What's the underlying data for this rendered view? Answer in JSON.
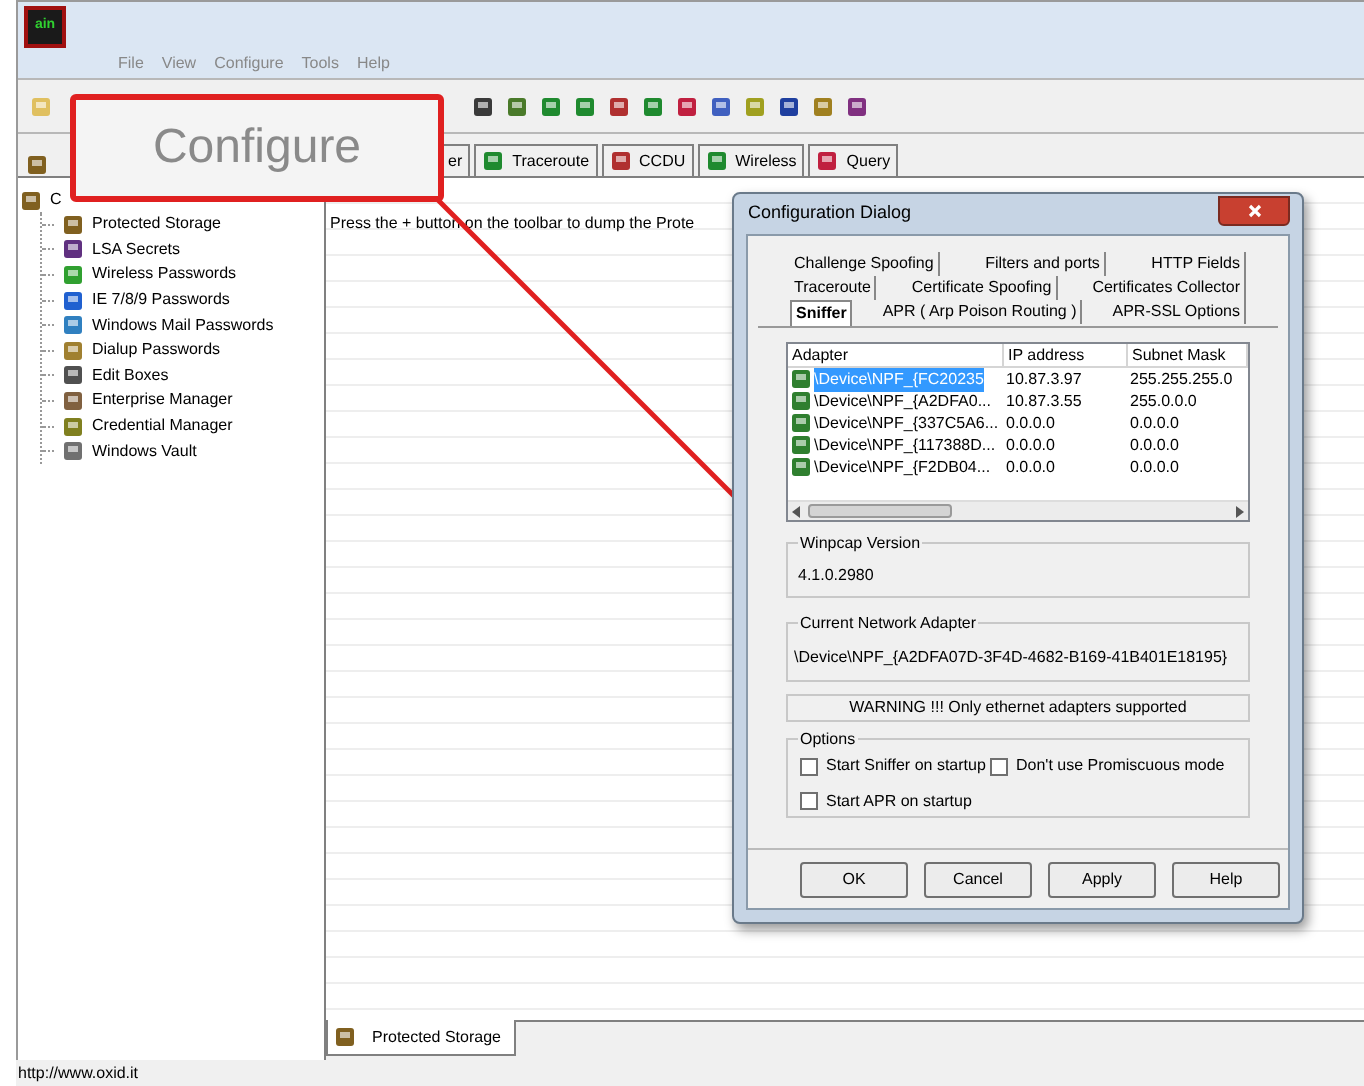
{
  "app": {
    "logo_text": "ain",
    "menu": [
      "File",
      "View",
      "Configure",
      "Tools",
      "Help"
    ]
  },
  "tabs": [
    {
      "label": "er"
    },
    {
      "label": "Traceroute"
    },
    {
      "label": "CCDU"
    },
    {
      "label": "Wireless"
    },
    {
      "label": "Query"
    }
  ],
  "callout": {
    "text": "Configure"
  },
  "tree": {
    "root": "C",
    "items": [
      "Protected Storage",
      "LSA Secrets",
      "Wireless Passwords",
      "IE 7/8/9 Passwords",
      "Windows Mail Passwords",
      "Dialup Passwords",
      "Edit Boxes",
      "Enterprise Manager",
      "Credential Manager",
      "Windows Vault"
    ]
  },
  "content": {
    "message": "Press the + button on the toolbar to dump the Prote"
  },
  "bottom_tab": {
    "label": "Protected Storage"
  },
  "status_bar": "http://www.oxid.it",
  "dialog": {
    "title": "Configuration Dialog",
    "tab_rows": [
      [
        {
          "label": "Challenge Spoofing",
          "selected": false
        },
        {
          "label": "Filters and ports",
          "selected": false
        },
        {
          "label": "HTTP Fields",
          "selected": false
        }
      ],
      [
        {
          "label": "Traceroute",
          "selected": false
        },
        {
          "label": "Certificate Spoofing",
          "selected": false
        },
        {
          "label": "Certificates Collector",
          "selected": false
        }
      ],
      [
        {
          "label": "Sniffer",
          "selected": true
        },
        {
          "label": "APR ( Arp Poison Routing )",
          "selected": false
        },
        {
          "label": "APR-SSL Options",
          "selected": false
        }
      ]
    ],
    "adapters": {
      "columns": [
        "Adapter",
        "IP address",
        "Subnet Mask"
      ],
      "rows": [
        {
          "cells": [
            "\\Device\\NPF_{FC20235",
            "10.87.3.97",
            "255.255.255.0"
          ],
          "selected": true
        },
        {
          "cells": [
            "\\Device\\NPF_{A2DFA0...",
            "10.87.3.55",
            "255.0.0.0"
          ],
          "selected": false
        },
        {
          "cells": [
            "\\Device\\NPF_{337C5A6...",
            "0.0.0.0",
            "0.0.0.0"
          ],
          "selected": false
        },
        {
          "cells": [
            "\\Device\\NPF_{117388D...",
            "0.0.0.0",
            "0.0.0.0"
          ],
          "selected": false
        },
        {
          "cells": [
            "\\Device\\NPF_{F2DB04...",
            "0.0.0.0",
            "0.0.0.0"
          ],
          "selected": false
        }
      ]
    },
    "winpcap": {
      "label": "Winpcap Version",
      "value": "4.1.0.2980"
    },
    "network_adapter": {
      "label": "Current Network Adapter",
      "value": "\\Device\\NPF_{A2DFA07D-3F4D-4682-B169-41B401E18195}"
    },
    "warning": "WARNING !!! Only ethernet adapters supported",
    "options": {
      "label": "Options",
      "checkboxes": [
        {
          "label": "Start Sniffer on startup",
          "checked": false
        },
        {
          "label": "Don't use Promiscuous mode",
          "checked": false
        },
        {
          "label": "Start APR on startup",
          "checked": false
        }
      ]
    },
    "buttons": [
      "OK",
      "Cancel",
      "Apply",
      "Help"
    ]
  }
}
